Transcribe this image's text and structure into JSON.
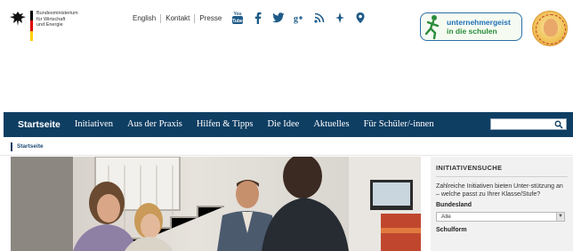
{
  "header": {
    "ministry_lines": [
      "Bundesministerium",
      "für Wirtschaft",
      "und Energie"
    ],
    "topnav": [
      "English",
      "Kontakt",
      "Presse"
    ],
    "social_icons": [
      "youtube-icon",
      "facebook-icon",
      "twitter-icon",
      "google-plus-icon",
      "rss-icon",
      "delicious-icon",
      "xing-icon"
    ],
    "ugs_logo": {
      "line1": "unternehmergeist",
      "line2": "in die schulen"
    },
    "flag_colors": [
      "#000000",
      "#dd0000",
      "#ffce00"
    ]
  },
  "mainnav": {
    "items": [
      "Startseite",
      "Initiativen",
      "Aus der Praxis",
      "Hilfen & Tipps",
      "Die Idee",
      "Aktuelles",
      "Für Schüler/-innen"
    ],
    "active_index": 0,
    "search_value": ""
  },
  "breadcrumb": "Startseite",
  "sidebar": {
    "title": "INITIATIVENSUCHE",
    "description": "Zahlreiche Initiativen bieten Unter-stützung an – welche passt zu Ihrer Klasse/Stufe?",
    "bundesland_label": "Bundesland",
    "bundesland_value": "Alle",
    "schulform_label": "Schulform"
  },
  "colors": {
    "nav_bg": "#0f3e63",
    "ugs_blue": "#1e70b8",
    "ugs_green": "#2a8c3a"
  }
}
